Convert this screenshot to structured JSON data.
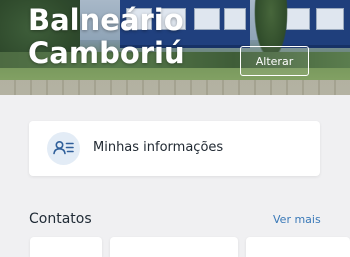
{
  "header": {
    "city_line1": "Balneário",
    "city_line2": "Camboriú",
    "change_button_label": "Alterar"
  },
  "info_card": {
    "label": "Minhas informações",
    "icon": "person-list-icon"
  },
  "contacts": {
    "title": "Contatos",
    "see_more_label": "Ver mais"
  },
  "colors": {
    "accent": "#3a79b8",
    "icon_bg": "#e3ecf6",
    "background": "#f0f0f2",
    "card": "#ffffff"
  }
}
